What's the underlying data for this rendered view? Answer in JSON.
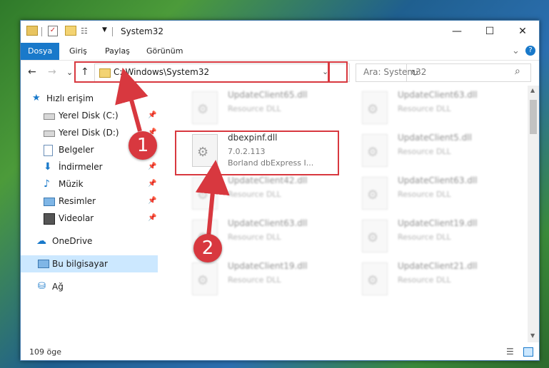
{
  "window": {
    "title": "System32",
    "controls": {
      "minimize": "—",
      "maximize": "☐",
      "close": "✕"
    }
  },
  "ribbon": {
    "tabs": [
      {
        "label": "Dosya",
        "active": true
      },
      {
        "label": "Giriş"
      },
      {
        "label": "Paylaş"
      },
      {
        "label": "Görünüm"
      }
    ],
    "expand": "⌄",
    "help": "?"
  },
  "nav": {
    "back": "←",
    "forward": "→",
    "recent": "⌄",
    "up": "↑",
    "address": "C:\\Windows\\System32",
    "address_dropdown": "⌄",
    "refresh": "↻",
    "search_placeholder": "Ara: System32",
    "search_icon": "⌕"
  },
  "sidebar": {
    "items": [
      {
        "label": "Hızlı erişim",
        "icon": "star-icon",
        "pinned": false
      },
      {
        "label": "Yerel Disk (C:)",
        "icon": "drive-icon",
        "pinned": true
      },
      {
        "label": "Yerel Disk (D:)",
        "icon": "drive-icon",
        "pinned": true
      },
      {
        "label": "Belgeler",
        "icon": "documents-icon",
        "pinned": true
      },
      {
        "label": "İndirmeler",
        "icon": "downloads-icon",
        "pinned": true
      },
      {
        "label": "Müzik",
        "icon": "music-icon",
        "pinned": true
      },
      {
        "label": "Resimler",
        "icon": "pictures-icon",
        "pinned": true
      },
      {
        "label": "Videolar",
        "icon": "videos-icon",
        "pinned": true
      },
      {
        "label": "OneDrive",
        "icon": "cloud-icon",
        "pinned": false
      },
      {
        "label": "Bu bilgisayar",
        "icon": "computer-icon",
        "pinned": false,
        "selected": true
      },
      {
        "label": "Ağ",
        "icon": "network-icon",
        "pinned": false
      }
    ],
    "pin_glyph": "📌"
  },
  "files": [
    {
      "name": "UpdateClient65.dll",
      "sub": "Resource DLL",
      "blurred": true
    },
    {
      "name": "UpdateClient63.dll",
      "sub": "Resource DLL",
      "blurred": true
    },
    {
      "name": "dbexpinf.dll",
      "sub": "7.0.2.113",
      "sub2": "Borland dbExpress I...",
      "blurred": false
    },
    {
      "name": "UpdateClient5.dll",
      "sub": "Resource DLL",
      "blurred": true
    },
    {
      "name": "UpdateClient42.dll",
      "sub": "Resource DLL",
      "blurred": true
    },
    {
      "name": "UpdateClient63.dll",
      "sub": "Resource DLL",
      "blurred": true
    },
    {
      "name": "UpdateClient63.dll",
      "sub": "Resource DLL",
      "blurred": true
    },
    {
      "name": "UpdateClient19.dll",
      "sub": "Resource DLL",
      "blurred": true
    },
    {
      "name": "UpdateClient19.dll",
      "sub": "Resource DLL",
      "blurred": true
    },
    {
      "name": "UpdateClient21.dll",
      "sub": "Resource DLL",
      "blurred": true
    }
  ],
  "status": {
    "count": "109 öge"
  },
  "annotations": {
    "step1": "1",
    "step2": "2",
    "highlight_color": "#d8383f"
  }
}
